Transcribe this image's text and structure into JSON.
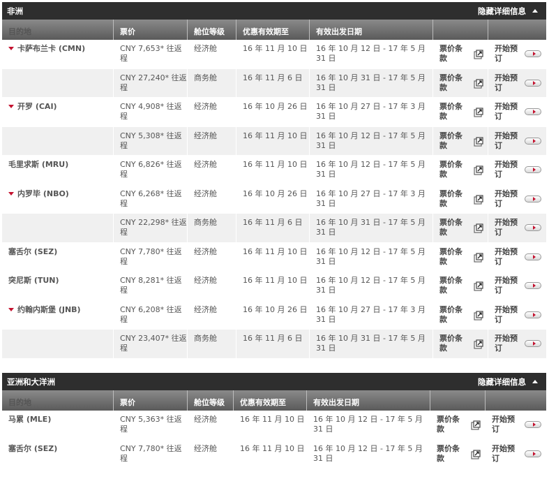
{
  "columns": {
    "destination": "目的地",
    "price": "票价",
    "cabin": "舱位等级",
    "valid_until": "优惠有效期至",
    "departure": "有效出发日期"
  },
  "toggle_label": "隐藏详细信息",
  "terms_label": "票价条款",
  "book_label": "开始预订",
  "colors": {
    "accent": "#c4122f",
    "header_bg": "#2e2e2e"
  },
  "sections": [
    {
      "title": "非洲",
      "rows": [
        {
          "dest": "卡萨布兰卡 (CMN)",
          "expand": true,
          "price": "CNY 7,653* 往返程",
          "cabin": "经济舱",
          "valid": "16 年 11 月 10 日",
          "dep": "16 年 10 月 12 日 - 17 年 5 月 31 日"
        },
        {
          "dest": "",
          "expand": false,
          "price": "CNY 27,240* 往返程",
          "cabin": "商务舱",
          "valid": "16 年 11 月 6 日",
          "dep": "16 年 10 月 31 日 - 17 年 5 月 31 日"
        },
        {
          "dest": "开罗 (CAI)",
          "expand": true,
          "price": "CNY 4,908* 往返程",
          "cabin": "经济舱",
          "valid": "16 年 10 月 26 日",
          "dep": "16 年 10 月 27 日 - 17 年 3 月 31 日"
        },
        {
          "dest": "",
          "expand": false,
          "price": "CNY 5,308* 往返程",
          "cabin": "经济舱",
          "valid": "16 年 11 月 10 日",
          "dep": "16 年 10 月 12 日 - 17 年 5 月 31 日"
        },
        {
          "dest": "毛里求斯 (MRU)",
          "expand": false,
          "price": "CNY 6,826* 往返程",
          "cabin": "经济舱",
          "valid": "16 年 11 月 10 日",
          "dep": "16 年 10 月 12 日 - 17 年 5 月 31 日"
        },
        {
          "dest": "内罗毕 (NBO)",
          "expand": true,
          "price": "CNY 6,268* 往返程",
          "cabin": "经济舱",
          "valid": "16 年 10 月 26 日",
          "dep": "16 年 10 月 27 日 - 17 年 3 月 31 日"
        },
        {
          "dest": "",
          "expand": false,
          "price": "CNY 22,298* 往返程",
          "cabin": "商务舱",
          "valid": "16 年 11 月 6 日",
          "dep": "16 年 10 月 31 日 - 17 年 5 月 31 日"
        },
        {
          "dest": "塞舌尔 (SEZ)",
          "expand": false,
          "price": "CNY 7,780* 往返程",
          "cabin": "经济舱",
          "valid": "16 年 11 月 10 日",
          "dep": "16 年 10 月 12 日 - 17 年 5 月 31 日"
        },
        {
          "dest": "突尼斯 (TUN)",
          "expand": false,
          "price": "CNY 8,281* 往返程",
          "cabin": "经济舱",
          "valid": "16 年 11 月 10 日",
          "dep": "16 年 10 月 12 日 - 17 年 5 月 31 日"
        },
        {
          "dest": "约翰内斯堡 (JNB)",
          "expand": true,
          "price": "CNY 6,208* 往返程",
          "cabin": "经济舱",
          "valid": "16 年 10 月 26 日",
          "dep": "16 年 10 月 27 日 - 17 年 3 月 31 日"
        },
        {
          "dest": "",
          "expand": false,
          "price": "CNY 23,407* 往返程",
          "cabin": "商务舱",
          "valid": "16 年 11 月 6 日",
          "dep": "16 年 10 月 31 日 - 17 年 5 月 31 日"
        }
      ]
    },
    {
      "title": "亚洲和大洋洲",
      "rows": [
        {
          "dest": "马累 (MLE)",
          "expand": false,
          "price": "CNY 5,363* 往返程",
          "cabin": "经济舱",
          "valid": "16 年 11 月 10 日",
          "dep": "16 年 10 月 12 日 - 17 年 5 月 31 日"
        },
        {
          "dest": "塞舌尔 (SEZ)",
          "expand": false,
          "price": "CNY 7,780* 往返程",
          "cabin": "经济舱",
          "valid": "16 年 11 月 10 日",
          "dep": "16 年 10 月 12 日 - 17 年 5 月 31 日"
        }
      ]
    }
  ]
}
